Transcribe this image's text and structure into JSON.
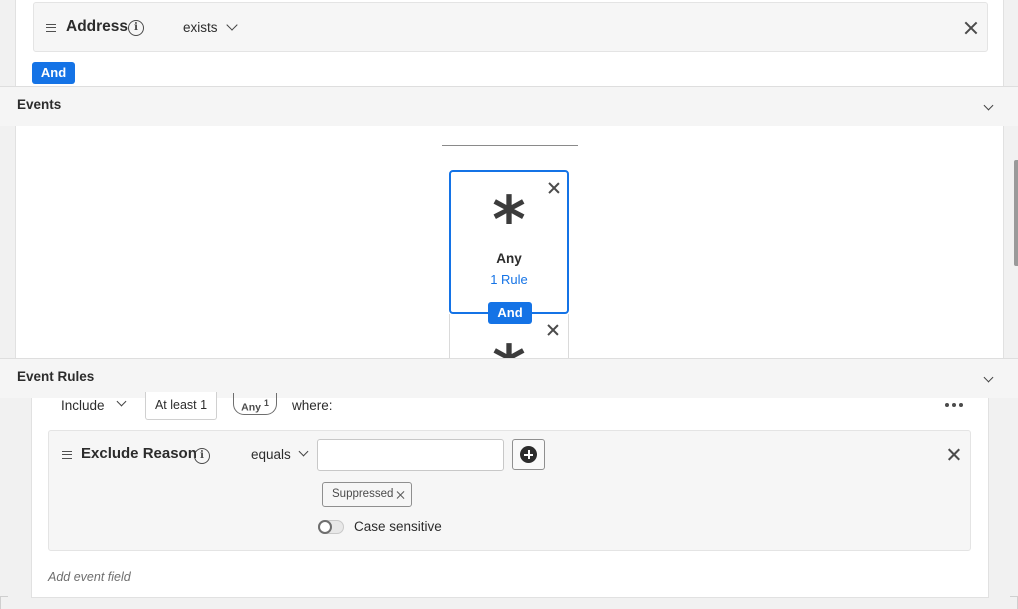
{
  "attribute_rule": {
    "field_label": "Address",
    "operator": "exists",
    "connector": "And"
  },
  "events_section": {
    "title": "Events",
    "cards": [
      {
        "title": "Any",
        "link": "1 Rule",
        "symbol": "*"
      },
      {
        "symbol": "*"
      }
    ],
    "connector": "And"
  },
  "event_rules_section": {
    "title": "Event Rules",
    "include_label": "Include",
    "count_label": "At least 1",
    "any_label": "Any",
    "any_superscript": "1",
    "where_label": "where:",
    "rule": {
      "field_label": "Exclude Reason",
      "operator": "equals",
      "input_value": "",
      "tags": [
        "Suppressed"
      ],
      "toggle_label": "Case sensitive",
      "case_sensitive": false
    },
    "add_field_label": "Add event field"
  }
}
